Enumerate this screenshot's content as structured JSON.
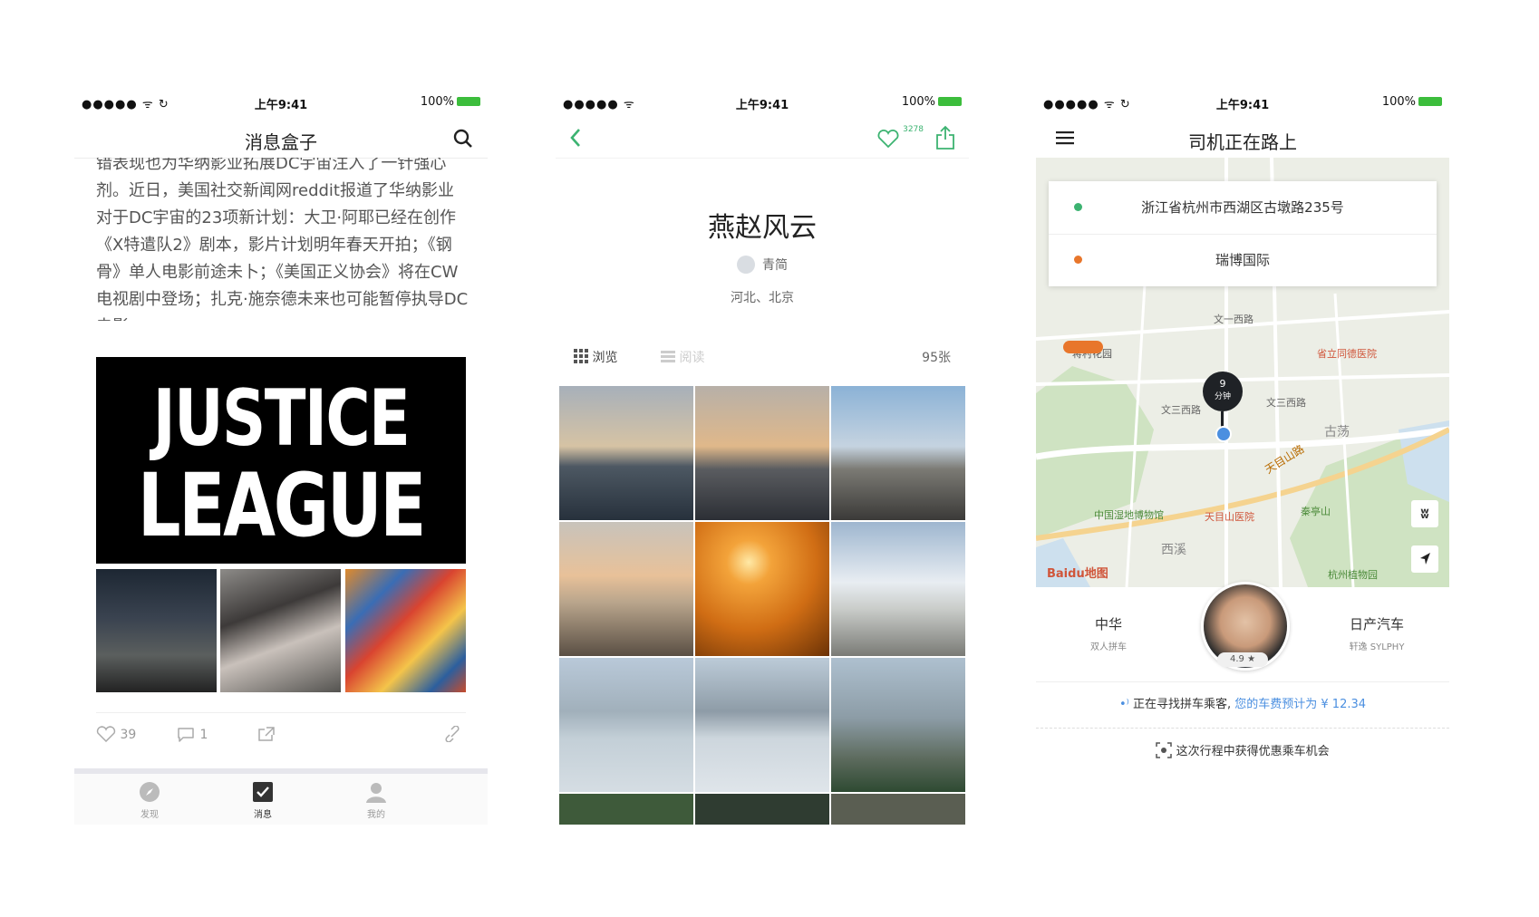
{
  "colors": {
    "accent_green": "#3cb371",
    "brand_blue": "#1e90ff",
    "orange": "#e8762b",
    "battery": "#3cbd3c"
  },
  "phone1": {
    "status": {
      "time": "上午9:41",
      "battery": "100%"
    },
    "nav_title": "消息盒子",
    "article_text": "错表现也为华纳影业拓展DC宇宙注入了一针强心剂。近日，美国社交新闻网reddit报道了华纳影业对于DC宇宙的23项新计划：大卫·阿耶已经在创作《X特遣队2》剧本，影片计划明年春天开拍；《钢骨》单人电影前途未卜；《美国正义协会》将在CW电视剧中登场；扎克·施奈德未来也可能暂停执导DC电影",
    "image_title_line1": "JUSTICE",
    "image_title_line2": "LEAGUE",
    "likes": "39",
    "comments": "1",
    "tabs": [
      {
        "label": "发现"
      },
      {
        "label": "消息"
      },
      {
        "label": "我的"
      }
    ]
  },
  "phone2": {
    "status": {
      "time": "上午9:41",
      "battery": "100%"
    },
    "like_count": "3278",
    "title": "燕赵风云",
    "author": "青简",
    "location": "河北、北京",
    "view_tab": "浏览",
    "read_tab": "阅读",
    "photo_count": "95张"
  },
  "phone3": {
    "status": {
      "time": "上午9:41",
      "battery": "100%"
    },
    "nav_title": "司机正在路上",
    "origin": "浙江省杭州市西湖区古墩路235号",
    "destination": "瑞博国际",
    "eta_number": "9",
    "eta_unit": "分钟",
    "map_labels": {
      "road1": "文一西路",
      "road2": "文三西路",
      "road3": "文三西路",
      "road4": "天目山路",
      "area1": "古荡",
      "area2": "西溪",
      "poi1": "蒋村花园",
      "poi2": "省立同德医院",
      "poi3": "中国湿地博物馆",
      "poi4": "天目山医院",
      "poi5": "秦亭山",
      "poi6": "杭州植物园",
      "brand": "Baidu地图"
    },
    "car_model": "中华",
    "car_sub": "双人拼车",
    "car_brand": "日产汽车",
    "car_brand_sub": "轩逸 SYLPHY",
    "rating": "4.9",
    "status_text": "正在寻找拼车乘客,",
    "fare_text": "您的车费预计为 ¥ 12.34",
    "promo": "这次行程中获得优惠乘车机会"
  }
}
